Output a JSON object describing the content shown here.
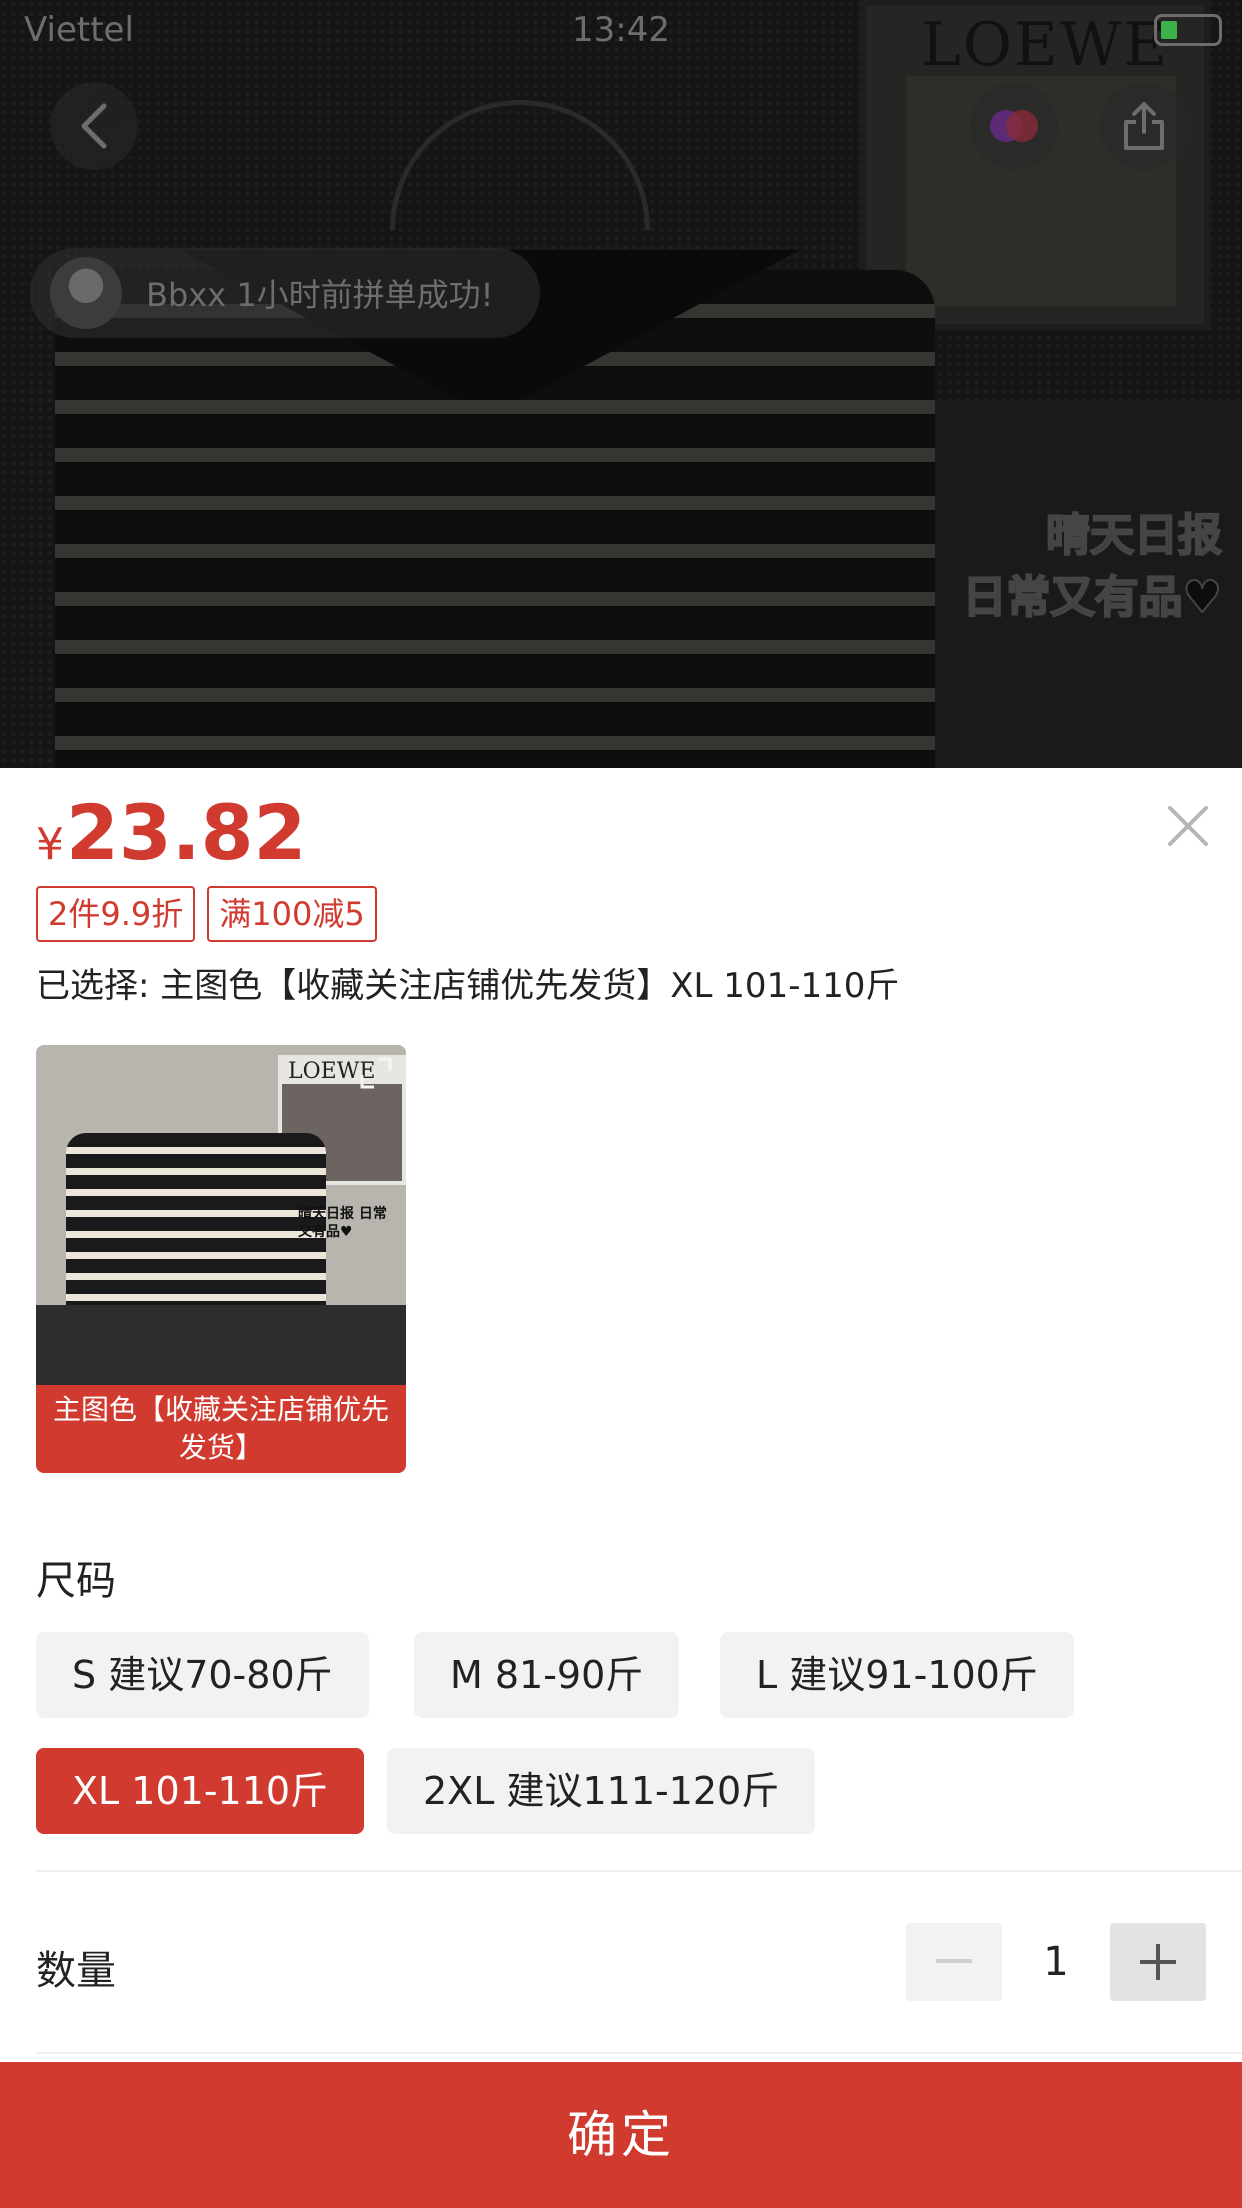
{
  "status_bar": {
    "carrier": "Viettel",
    "time": "13:42"
  },
  "background": {
    "poster_text": "LOEWE",
    "slogan_line1": "晴天日报",
    "slogan_line2": "日常又有品♥"
  },
  "toast": {
    "message": "Bbxx 1小时前拼单成功!"
  },
  "icons": {
    "back": "chevron-left-icon",
    "multi": "multi-color-icon",
    "share": "share-icon",
    "close": "close-icon",
    "expand": "expand-icon",
    "minus": "minus-icon",
    "plus": "plus-icon"
  },
  "price": {
    "currency": "¥",
    "value": "23.82"
  },
  "tags": [
    "2件9.9折",
    "满100减5"
  ],
  "selected_text": "已选择: 主图色【收藏关注店铺优先发货】XL 101-110斤",
  "color_option": {
    "label": "主图色【收藏关注店铺优先发货】",
    "thumb_text": "晴天日报 日常又有品♥",
    "thumb_poster": "LOEWE"
  },
  "size": {
    "title": "尺码",
    "options": [
      {
        "label": "S 建议70-80斤",
        "selected": false
      },
      {
        "label": "M 81-90斤",
        "selected": false
      },
      {
        "label": "L 建议91-100斤",
        "selected": false
      },
      {
        "label": "XL 101-110斤",
        "selected": true
      },
      {
        "label": "2XL 建议111-120斤",
        "selected": false
      }
    ]
  },
  "quantity": {
    "title": "数量",
    "value": "1"
  },
  "confirm_label": "确定",
  "colors": {
    "accent": "#d03a2f",
    "option_bg": "#f2f2f2"
  }
}
